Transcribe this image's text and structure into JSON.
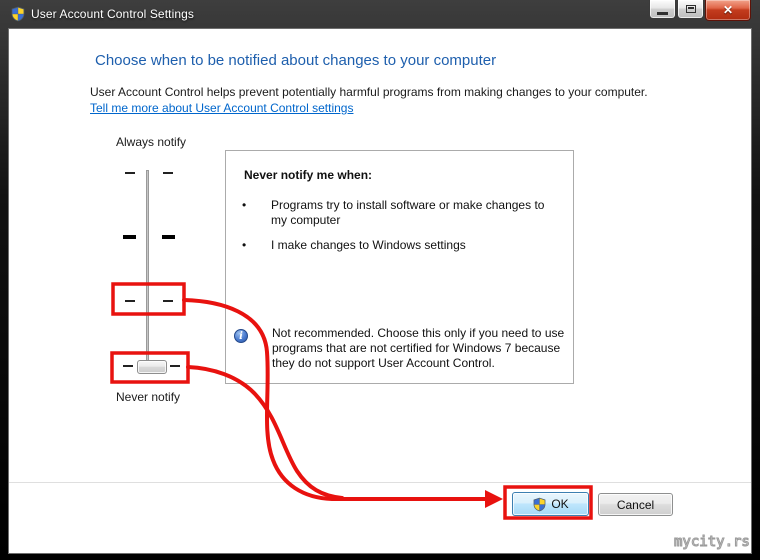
{
  "window": {
    "title": "User Account Control Settings",
    "controls": {
      "minimize": "minimize",
      "maximize": "maximize",
      "close": "close"
    }
  },
  "header": {
    "title": "Choose when to be notified about changes to your computer",
    "description": "User Account Control helps prevent potentially harmful programs from making changes to your computer.",
    "link": "Tell me more about User Account Control settings"
  },
  "slider": {
    "top_label": "Always notify",
    "bottom_label": "Never notify",
    "levels": 4,
    "current_position": "Never notify"
  },
  "info_box": {
    "title": "Never notify me when:",
    "bullets": [
      "Programs try to install software or make changes to my computer",
      "I make changes to Windows settings"
    ],
    "note": "Not recommended. Choose this only if you need to use programs that are not certified for Windows 7 because they do not support User Account Control."
  },
  "buttons": {
    "ok": "OK",
    "cancel": "Cancel"
  },
  "watermark": "mycity.rs",
  "icons": {
    "close_glyph": "✕",
    "info_glyph": "i",
    "bullet_glyph": "•"
  },
  "colors": {
    "annotation_red": "#e8120f",
    "heading_blue": "#1e5fad",
    "link_blue": "#0066cc",
    "titlebar": "#000000"
  }
}
